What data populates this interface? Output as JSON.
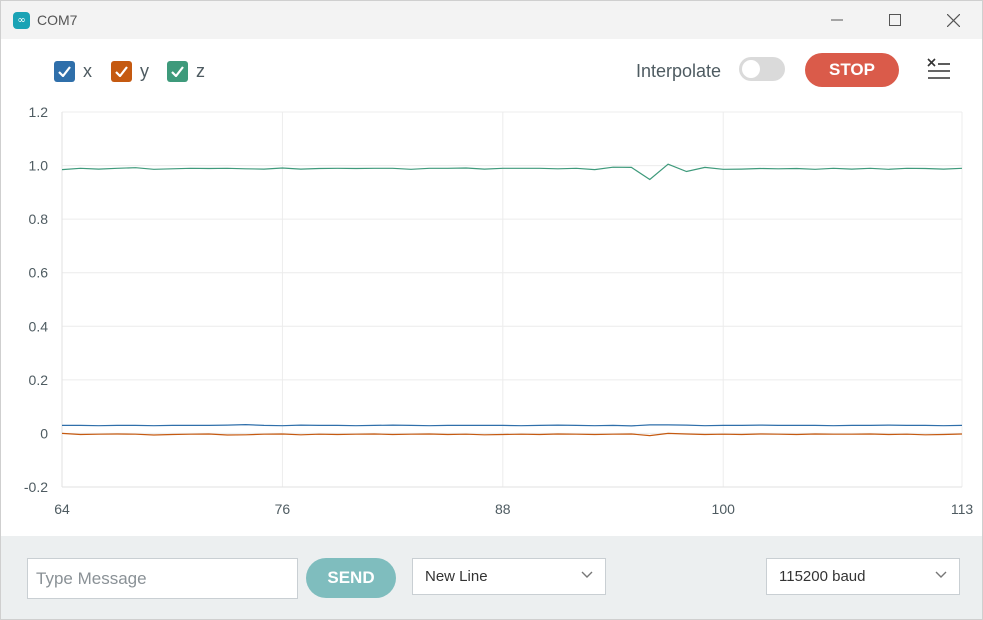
{
  "window": {
    "title": "COM7",
    "icon": "arduino-infinity-icon"
  },
  "toolbar": {
    "legend": [
      {
        "label": "x",
        "color": "#2f6faa",
        "checked": true
      },
      {
        "label": "y",
        "color": "#c55a11",
        "checked": true
      },
      {
        "label": "z",
        "color": "#3e9a7b",
        "checked": true
      }
    ],
    "interpolate_label": "Interpolate",
    "interpolate_on": false,
    "stop_label": "STOP",
    "clear_icon": "clear-output-icon"
  },
  "footer": {
    "message_placeholder": "Type Message",
    "message_value": "",
    "send_label": "SEND",
    "line_ending": "New Line",
    "baud_rate": "115200 baud"
  },
  "chart_data": {
    "type": "line",
    "xlim": [
      64,
      113
    ],
    "ylim": [
      -0.2,
      1.2
    ],
    "x_ticks": [
      "64",
      "76",
      "88",
      "100",
      "113"
    ],
    "y_ticks": [
      "1.2",
      "1.0",
      "0.8",
      "0.6",
      "0.4",
      "0.2",
      "0",
      "-0.2"
    ],
    "grid": true,
    "legend_placement": "top-left",
    "series": [
      {
        "name": "x",
        "color": "#2f6faa",
        "x": [
          64,
          65,
          66,
          67,
          68,
          69,
          70,
          71,
          72,
          73,
          74,
          75,
          76,
          77,
          78,
          79,
          80,
          81,
          82,
          83,
          84,
          85,
          86,
          87,
          88,
          89,
          90,
          91,
          92,
          93,
          94,
          95,
          96,
          97,
          98,
          99,
          100,
          101,
          102,
          103,
          104,
          105,
          106,
          107,
          108,
          109,
          110,
          111,
          112,
          113
        ],
        "y": [
          0.03,
          0.03,
          0.029,
          0.03,
          0.03,
          0.029,
          0.03,
          0.03,
          0.03,
          0.031,
          0.033,
          0.03,
          0.029,
          0.031,
          0.03,
          0.03,
          0.029,
          0.03,
          0.031,
          0.03,
          0.029,
          0.03,
          0.03,
          0.03,
          0.03,
          0.029,
          0.03,
          0.031,
          0.03,
          0.029,
          0.03,
          0.028,
          0.032,
          0.032,
          0.031,
          0.029,
          0.03,
          0.03,
          0.031,
          0.03,
          0.03,
          0.03,
          0.029,
          0.03,
          0.03,
          0.031,
          0.03,
          0.03,
          0.029,
          0.03
        ]
      },
      {
        "name": "y",
        "color": "#c55a11",
        "x": [
          64,
          65,
          66,
          67,
          68,
          69,
          70,
          71,
          72,
          73,
          74,
          75,
          76,
          77,
          78,
          79,
          80,
          81,
          82,
          83,
          84,
          85,
          86,
          87,
          88,
          89,
          90,
          91,
          92,
          93,
          94,
          95,
          96,
          97,
          98,
          99,
          100,
          101,
          102,
          103,
          104,
          105,
          106,
          107,
          108,
          109,
          110,
          111,
          112,
          113
        ],
        "y": [
          0.0,
          -0.004,
          -0.003,
          -0.002,
          -0.003,
          -0.006,
          -0.004,
          -0.003,
          -0.002,
          -0.006,
          -0.005,
          -0.003,
          -0.002,
          -0.005,
          -0.003,
          -0.004,
          -0.003,
          -0.002,
          -0.004,
          -0.003,
          -0.002,
          -0.004,
          -0.003,
          -0.005,
          -0.004,
          -0.003,
          -0.004,
          -0.002,
          -0.003,
          -0.004,
          -0.003,
          -0.002,
          -0.008,
          0.0,
          -0.002,
          -0.004,
          -0.003,
          -0.004,
          -0.002,
          -0.003,
          -0.004,
          -0.002,
          -0.003,
          -0.003,
          -0.002,
          -0.004,
          -0.003,
          -0.005,
          -0.004,
          -0.002
        ]
      },
      {
        "name": "z",
        "color": "#3e9a7b",
        "x": [
          64,
          65,
          66,
          67,
          68,
          69,
          70,
          71,
          72,
          73,
          74,
          75,
          76,
          77,
          78,
          79,
          80,
          81,
          82,
          83,
          84,
          85,
          86,
          87,
          88,
          89,
          90,
          91,
          92,
          93,
          94,
          95,
          96,
          97,
          98,
          99,
          100,
          101,
          102,
          103,
          104,
          105,
          106,
          107,
          108,
          109,
          110,
          111,
          112,
          113
        ],
        "y": [
          0.985,
          0.99,
          0.987,
          0.99,
          0.992,
          0.986,
          0.988,
          0.99,
          0.989,
          0.99,
          0.988,
          0.987,
          0.991,
          0.987,
          0.989,
          0.99,
          0.989,
          0.99,
          0.99,
          0.986,
          0.99,
          0.99,
          0.991,
          0.987,
          0.99,
          0.99,
          0.99,
          0.988,
          0.99,
          0.985,
          0.994,
          0.993,
          0.948,
          1.005,
          0.978,
          0.993,
          0.986,
          0.987,
          0.989,
          0.988,
          0.989,
          0.986,
          0.99,
          0.987,
          0.99,
          0.986,
          0.99,
          0.989,
          0.987,
          0.99
        ]
      }
    ]
  }
}
